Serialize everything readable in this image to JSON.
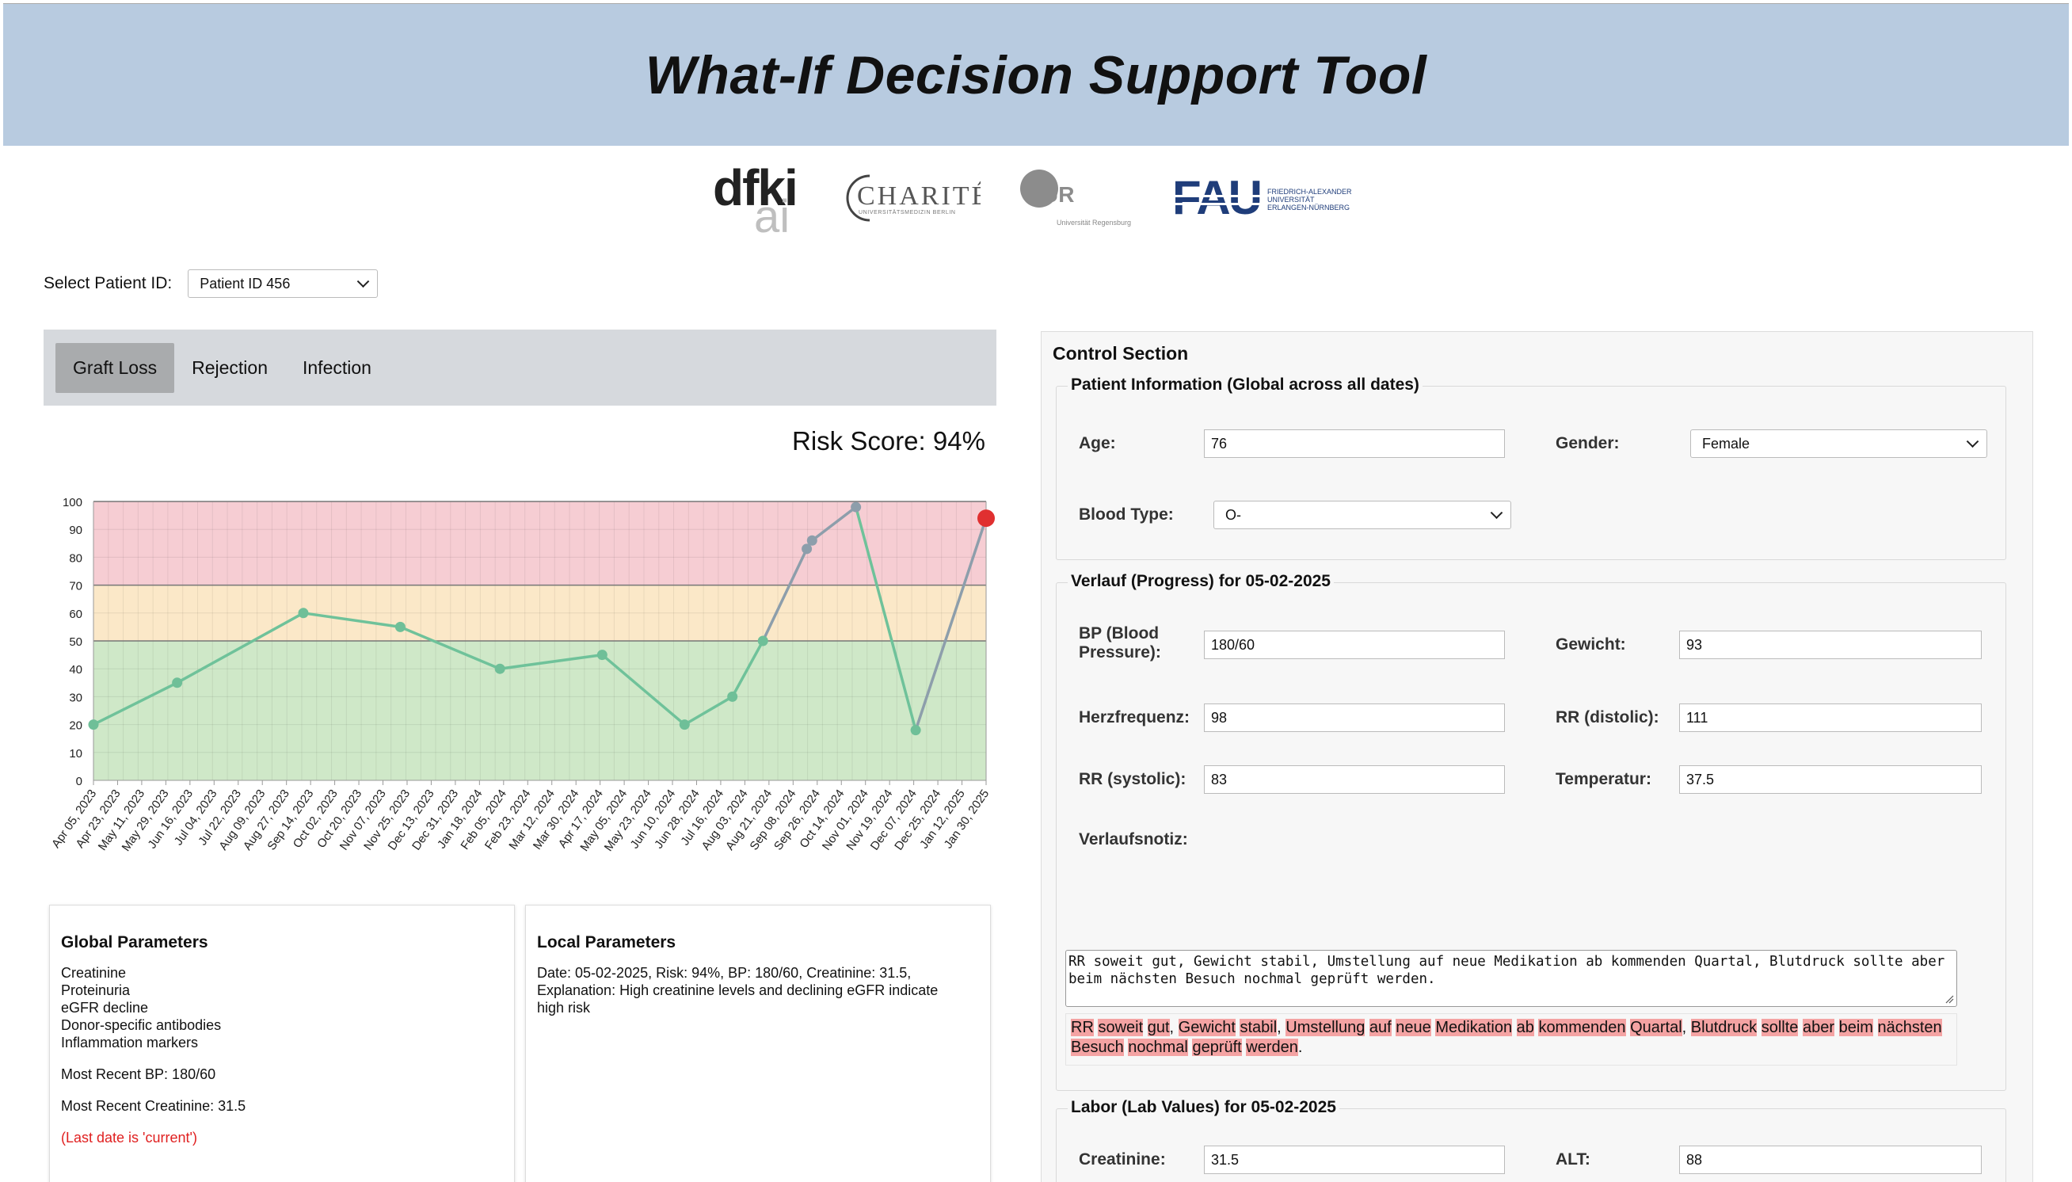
{
  "header": {
    "title": "What-If Decision Support Tool"
  },
  "logos": {
    "dfki_top": "dfki",
    "dfki_bottom": "ai",
    "charite": "CHARITÉ",
    "charite_sub": "UNIVERSITÄTSMEDIZIN BERLIN",
    "ur": "UR",
    "ur_sub": "Universität Regensburg",
    "fau": "FAU",
    "fau_sub1": "FRIEDRICH-ALEXANDER",
    "fau_sub2": "UNIVERSITÄT",
    "fau_sub3": "ERLANGEN-NÜRNBERG"
  },
  "patient_select": {
    "label": "Select Patient ID:",
    "value": "Patient ID 456"
  },
  "tabs": [
    {
      "label": "Graft Loss",
      "active": true
    },
    {
      "label": "Rejection",
      "active": false
    },
    {
      "label": "Infection",
      "active": false
    }
  ],
  "risk_score": "Risk Score: 94%",
  "chart_data": {
    "type": "line",
    "x": [
      "Apr 05, 2023",
      "Apr 23, 2023",
      "May 11, 2023",
      "May 29, 2023",
      "Jun 16, 2023",
      "Jul 04, 2023",
      "Jul 22, 2023",
      "Aug 09, 2023",
      "Aug 27, 2023",
      "Sep 14, 2023",
      "Oct 02, 2023",
      "Oct 20, 2023",
      "Nov 07, 2023",
      "Nov 25, 2023",
      "Dec 13, 2023",
      "Dec 31, 2023",
      "Jan 18, 2024",
      "Feb 05, 2024",
      "Feb 23, 2024",
      "Mar 12, 2024",
      "Mar 30, 2024",
      "Apr 17, 2024",
      "May 05, 2024",
      "May 23, 2024",
      "Jun 10, 2024",
      "Jun 28, 2024",
      "Jul 16, 2024",
      "Aug 03, 2024",
      "Aug 21, 2024",
      "Sep 08, 2024",
      "Sep 26, 2024",
      "Oct 14, 2024",
      "Nov 01, 2024",
      "Nov 19, 2024",
      "Dec 07, 2024",
      "Dec 25, 2024",
      "Jan 12, 2025",
      "Jan 30, 2025"
    ],
    "points": [
      {
        "date": "2023-04-05",
        "value": 20
      },
      {
        "date": "2023-06-07",
        "value": 35
      },
      {
        "date": "2023-09-10",
        "value": 60
      },
      {
        "date": "2023-11-22",
        "value": 55
      },
      {
        "date": "2024-02-05",
        "value": 40
      },
      {
        "date": "2024-04-22",
        "value": 45
      },
      {
        "date": "2024-06-23",
        "value": 20
      },
      {
        "date": "2024-07-29",
        "value": 30
      },
      {
        "date": "2024-08-21",
        "value": 50
      },
      {
        "date": "2024-09-23",
        "value": 83
      },
      {
        "date": "2024-09-27",
        "value": 86
      },
      {
        "date": "2024-10-30",
        "value": 98
      },
      {
        "date": "2024-12-14",
        "value": 18
      },
      {
        "date": "2025-02-05",
        "value": 94,
        "current": true
      }
    ],
    "yticks": [
      0,
      10,
      20,
      30,
      40,
      50,
      60,
      70,
      80,
      90,
      100
    ],
    "ylim": [
      0,
      100
    ],
    "bands": [
      {
        "from": 0,
        "to": 50,
        "color": "#cfe8c8"
      },
      {
        "from": 50,
        "to": 70,
        "color": "#fbe8c8"
      },
      {
        "from": 70,
        "to": 100,
        "color": "#f6cdd3"
      }
    ],
    "line_color_low": "#6fc29a",
    "line_color_high": "#8d9eab",
    "point_color": "#6fbf98",
    "current_point_color": "#e03030",
    "grid": true
  },
  "global_params": {
    "title": "Global Parameters",
    "list": [
      "Creatinine",
      "Proteinuria",
      "eGFR decline",
      "Donor-specific antibodies",
      "Inflammation markers"
    ],
    "recent_bp": "Most Recent BP: 180/60",
    "recent_creatinine": "Most Recent Creatinine: 31.5",
    "note": "(Last date is 'current')"
  },
  "local_params": {
    "title": "Local Parameters",
    "line1": "Date: 05-02-2025, Risk: 94%, BP: 180/60, Creatinine: 31.5,",
    "line2": "Explanation: High creatinine levels and declining eGFR indicate",
    "line3": "high risk"
  },
  "control": {
    "title": "Control Section",
    "patient_info": {
      "legend": "Patient Information (Global across all dates)",
      "age_label": "Age:",
      "age": "76",
      "gender_label": "Gender:",
      "gender": "Female",
      "blood_label": "Blood Type:",
      "blood": "O-"
    },
    "verlauf": {
      "legend": "Verlauf (Progress) for 05-02-2025",
      "bp_label_1": "BP (Blood",
      "bp_label_2": "Pressure):",
      "bp": "180/60",
      "gewicht_label": "Gewicht:",
      "gewicht": "93",
      "herz_label": "Herzfrequenz:",
      "herz": "98",
      "rr_dia_label": "RR (distolic):",
      "rr_dia": "111",
      "rr_sys_label": "RR (systolic):",
      "rr_sys": "83",
      "temp_label": "Temperatur:",
      "temp": "37.5",
      "notiz_label": "Verlaufsnotiz:",
      "notiz_text": "RR soweit gut, Gewicht stabil, Umstellung auf neue Medikation ab kommenden Quartal, Blutdruck sollte aber beim nächsten Besuch nochmal geprüft werden."
    },
    "labor": {
      "legend": "Labor (Lab Values) for 05-02-2025",
      "creat_label": "Creatinine:",
      "creat": "31.5",
      "alt_label": "ALT:",
      "alt": "88"
    }
  }
}
